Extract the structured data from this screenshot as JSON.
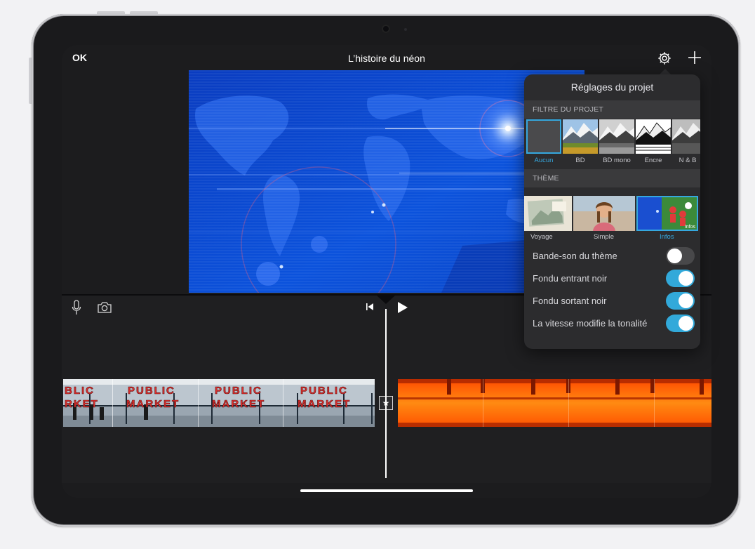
{
  "topbar": {
    "ok_label": "OK",
    "title": "L’histoire du néon"
  },
  "project_settings": {
    "title": "Réglages du projet",
    "filter_section": "FILTRE DU PROJET",
    "filters": [
      {
        "label": "Aucun",
        "selected": true
      },
      {
        "label": "BD",
        "selected": false
      },
      {
        "label": "BD mono",
        "selected": false
      },
      {
        "label": "Encre",
        "selected": false
      },
      {
        "label": "N & B",
        "selected": false
      }
    ],
    "theme_section": "THÈME",
    "themes": [
      {
        "label": "Voyage",
        "selected": false
      },
      {
        "label": "Simple",
        "selected": false
      },
      {
        "label": "Infos",
        "selected": true,
        "badge": "Infos"
      }
    ],
    "toggles": [
      {
        "label": "Bande-son du thème",
        "on": false
      },
      {
        "label": "Fondu entrant noir",
        "on": true
      },
      {
        "label": "Fondu sortant noir",
        "on": true
      },
      {
        "label": "La vitesse modifie la tonalité",
        "on": true
      }
    ]
  },
  "timeline": {
    "clip1_sign_line1": "PUBLIC",
    "clip1_sign_line2": "MARKET",
    "clip1_partial_line1": "BLIC",
    "clip1_partial_line2": "RKET",
    "transition_icon": "★"
  },
  "colors": {
    "accent": "#32a9da",
    "viewer_blue": "#0b4fd6",
    "clip_orange": "#ff6a00"
  }
}
